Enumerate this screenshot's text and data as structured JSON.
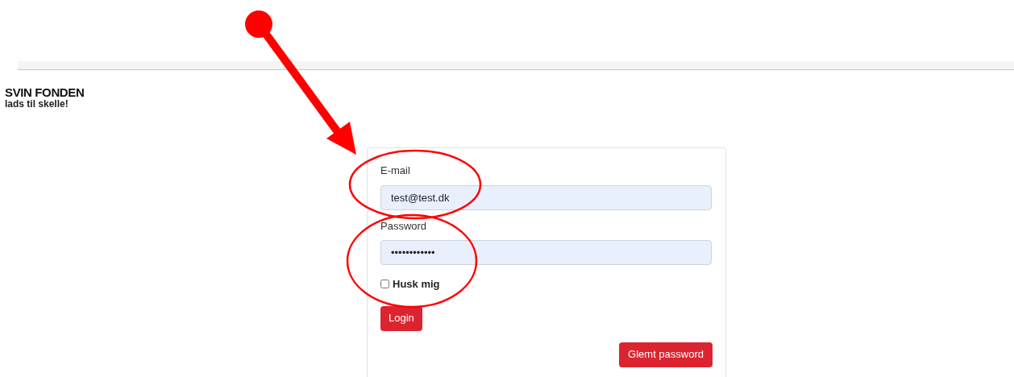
{
  "logo": {
    "title": "SVIN FONDEN",
    "tagline": "lads til skelle!"
  },
  "form": {
    "fields": [
      {
        "label": "E-mail",
        "value": "test@test.dk"
      },
      {
        "label": "Password",
        "value": "••••••••••••"
      }
    ],
    "remember": {
      "label": "Husk mig",
      "checked": false
    },
    "buttons": [
      "Login",
      "Glemt password"
    ]
  }
}
